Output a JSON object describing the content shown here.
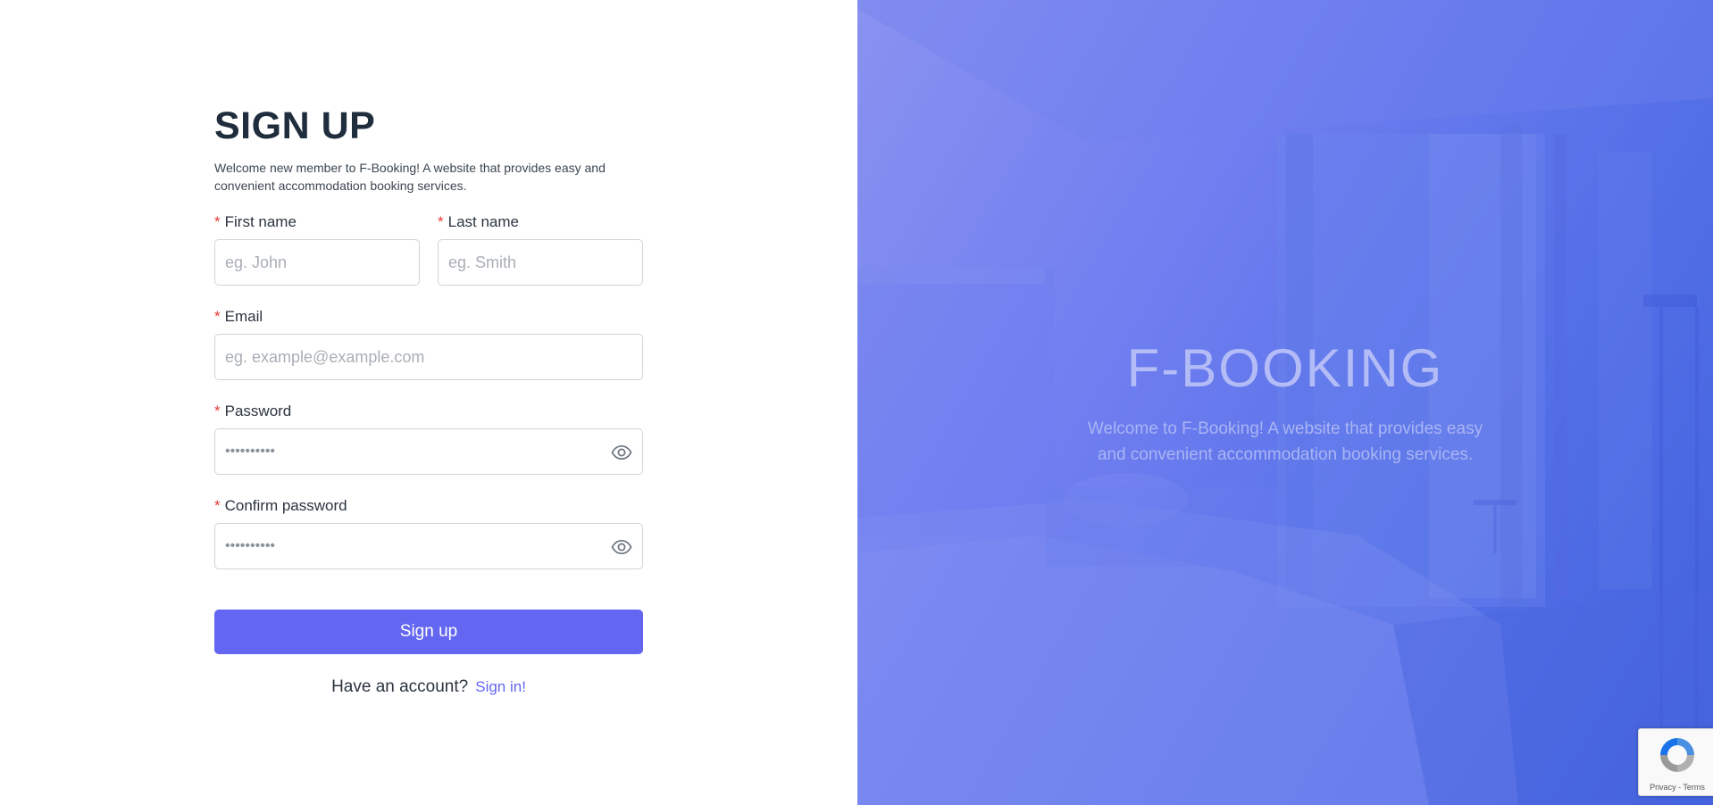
{
  "signup": {
    "title": "SIGN UP",
    "subtitle": "Welcome new member to F-Booking! A website that provides easy and convenient accommodation booking services.",
    "required_mark": "*",
    "first_name": {
      "label": "First name",
      "placeholder": "eg. John"
    },
    "last_name": {
      "label": "Last name",
      "placeholder": "eg. Smith"
    },
    "email": {
      "label": "Email",
      "placeholder": "eg. example@example.com"
    },
    "password": {
      "label": "Password",
      "value": "••••••••••"
    },
    "confirm_password": {
      "label": "Confirm password",
      "value": "••••••••••"
    },
    "submit_label": "Sign up",
    "account_prompt": "Have an account?",
    "signin_link": "Sign in!"
  },
  "hero": {
    "brand": "F-BOOKING",
    "tagline": "Welcome to F-Booking! A website that provides easy and convenient accommodation booking services."
  },
  "recaptcha": {
    "privacy": "Privacy",
    "separator": " - ",
    "terms": "Terms"
  },
  "colors": {
    "accent": "#6366f1",
    "required": "#e53935",
    "heading": "#1f2d3d",
    "hero_gradient_start": "#8a92f0",
    "hero_gradient_end": "#3f61dc"
  },
  "icons": {
    "password_toggle": "eye-icon",
    "confirm_password_toggle": "eye-icon",
    "recaptcha": "recaptcha-logo-icon"
  }
}
